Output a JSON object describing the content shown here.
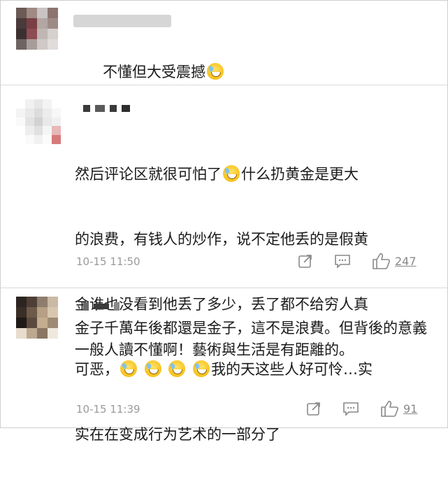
{
  "comments": [
    {
      "name_hidden": true,
      "text": "不懂但大受震撼",
      "emoji": "sweat-smile-emoji"
    },
    {
      "name_hidden": true,
      "text_line1": "然后评论区就很可怕了",
      "text_line1b": "什么扔黄金是更大",
      "text_rest1": "的浪费，有钱人的炒作，说不定他丢的是假黄",
      "text_rest2": "金谁也没看到他丢了多少，丢了都不给穷人真",
      "text_line4a": "可恶，",
      "text_line4b": "我的天这些人好可怜…实",
      "text_line5": "实在在变成行为艺术的一部分了",
      "time": "10-15 11:50",
      "likes": "247"
    },
    {
      "name_hidden": true,
      "text": "金子千萬年後都還是金子，這不是浪費。但背後的意義一般人讀不懂啊！藝術與生活是有距離的。",
      "time": "10-15 11:39",
      "likes": "91"
    }
  ],
  "icons": [
    "share-icon",
    "comment-icon",
    "like-icon"
  ],
  "colors": {
    "text": "#1a1a1a",
    "meta": "#9a9a9a",
    "divider": "#d9d9d9",
    "icon": "#888888"
  }
}
